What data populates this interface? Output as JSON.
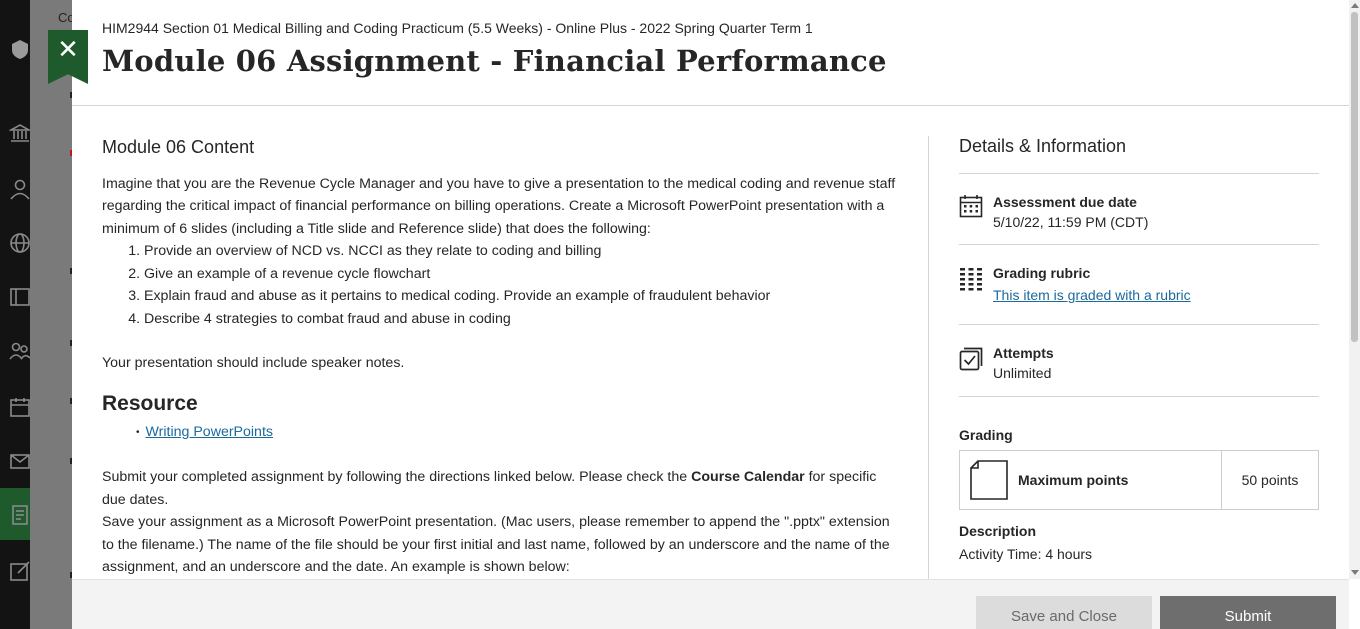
{
  "background": {
    "course_abbrev": "Co"
  },
  "nav_icons": [
    "institution-icon",
    "profile-icon",
    "globe-icon",
    "courses-icon",
    "groups-icon",
    "calendar-icon",
    "messages-icon",
    "grades-icon",
    "tools-icon"
  ],
  "panel": {
    "close_icon": "✕",
    "course_title": "HIM2944 Section 01 Medical Billing and Coding Practicum (5.5 Weeks) - Online Plus - 2022 Spring Quarter Term 1",
    "page_title": "Module 06 Assignment - Financial Performance"
  },
  "content": {
    "section_heading": "Module 06 Content",
    "intro": "Imagine that you are the Revenue Cycle Manager and you have to give a presentation to the medical coding and revenue staff regarding the critical impact of financial performance on billing operations. Create a Microsoft PowerPoint presentation with a minimum of 6 slides (including a Title slide and Reference slide) that does the following:",
    "tasks": [
      "Provide an overview of NCD vs. NCCI as they relate to coding and billing",
      "Give an example of a revenue cycle flowchart",
      "Explain fraud and abuse as it pertains to medical coding. Provide an example of fraudulent behavior",
      "Describe 4 strategies to combat fraud and abuse in coding"
    ],
    "speaker_notes": "Your presentation should include speaker notes.",
    "resource_heading": "Resource",
    "resource_link": "Writing PowerPoints",
    "submit_text_before": "Submit your completed assignment by following the directions linked below. Please check the ",
    "submit_text_bold": "Course Calendar",
    "submit_text_after": " for specific due dates.",
    "save_text": "Save your assignment as a Microsoft PowerPoint presentation. (Mac users, please remember to append the \".pptx\" extension to the filename.) The name of the file should be your first initial and last name, followed by an underscore and the name of the assignment, and an underscore and the date. An example is shown below:"
  },
  "sidebar": {
    "heading": "Details & Information",
    "due_label": "Assessment due date",
    "due_value": "5/10/22, 11:59 PM (CDT)",
    "rubric_label": "Grading rubric",
    "rubric_link": "This item is graded with a rubric",
    "attempts_label": "Attempts",
    "attempts_value": "Unlimited",
    "grading_label": "Grading",
    "max_points_label": "Maximum points",
    "max_points_value": "50 points",
    "description_label": "Description",
    "description_value": "Activity Time: 4 hours"
  },
  "footer": {
    "save_close_label": "Save and Close",
    "submit_label": "Submit"
  },
  "colors": {
    "accent_green": "#1f5a2c",
    "link_blue": "#1b6a9e",
    "submit_gray": "#6e6e6e"
  }
}
